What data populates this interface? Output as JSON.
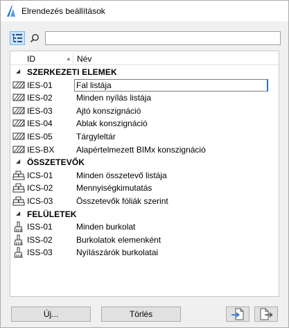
{
  "window": {
    "title": "Elrendezés beállítások"
  },
  "toolbar": {
    "search_value": "",
    "search_placeholder": ""
  },
  "list": {
    "columns": {
      "id": "ID",
      "name": "Név"
    },
    "groups": [
      {
        "label": "SZERKEZETI ELEMEK",
        "icon": "hatch-icon",
        "items": [
          {
            "id": "IES-01",
            "name": "Fal listája",
            "selected": true
          },
          {
            "id": "IES-02",
            "name": "Minden nyílás listája"
          },
          {
            "id": "IES-03",
            "name": "Ajtó konszignáció"
          },
          {
            "id": "IES-04",
            "name": "Ablak konszignáció"
          },
          {
            "id": "IES-05",
            "name": "Tárgyleltár"
          },
          {
            "id": "IES-BX",
            "name": "Alapértelmezett BIMx konszignáció"
          }
        ]
      },
      {
        "label": "ÖSSZETEVŐK",
        "icon": "stack-icon",
        "items": [
          {
            "id": "ICS-01",
            "name": "Minden összetevő listája"
          },
          {
            "id": "ICS-02",
            "name": "Mennyiségkimutatás"
          },
          {
            "id": "ICS-03",
            "name": "Összetevők fóliák szerint"
          }
        ]
      },
      {
        "label": "FELÜLETEK",
        "icon": "paintbrush-icon",
        "items": [
          {
            "id": "ISS-01",
            "name": "Minden burkolat"
          },
          {
            "id": "ISS-02",
            "name": "Burkolatok elemenként"
          },
          {
            "id": "ISS-03",
            "name": "Nyílászárók burkolatai"
          }
        ]
      }
    ]
  },
  "buttons": {
    "new": "Új...",
    "delete": "Törlés"
  }
}
